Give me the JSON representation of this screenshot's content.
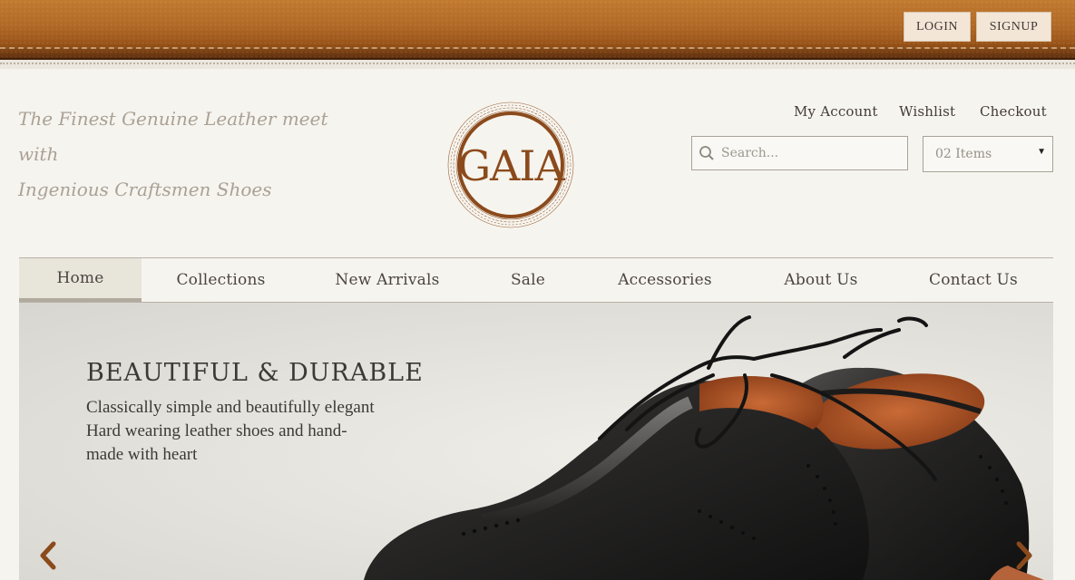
{
  "auth": {
    "login_label": "LOGIN",
    "signup_label": "SIGNUP"
  },
  "tagline": {
    "line1": "The Finest Genuine Leather meet with",
    "line2": "Ingenious Craftsmen Shoes"
  },
  "logo": {
    "text": "GAIA"
  },
  "top_links": [
    {
      "label": "My Account"
    },
    {
      "label": "Wishlist"
    },
    {
      "label": "Checkout"
    }
  ],
  "search": {
    "placeholder": "Search..."
  },
  "cart": {
    "label": "02 Items"
  },
  "nav": [
    {
      "label": "Home",
      "active": true
    },
    {
      "label": "Collections"
    },
    {
      "label": "New Arrivals"
    },
    {
      "label": "Sale"
    },
    {
      "label": "Accessories"
    },
    {
      "label": "About Us"
    },
    {
      "label": "Contact Us"
    }
  ],
  "hero": {
    "title": "BEAUTIFUL & DURABLE",
    "line1": "Classically simple and beautifully elegant",
    "line2": "Hard wearing leather shoes and hand-",
    "line3": "made with heart"
  },
  "colors": {
    "leather": "#b06826",
    "accent": "#8b4a1c",
    "background": "#f6f4ee"
  },
  "icons": {
    "search": "search-icon",
    "caret": "dropdown-caret-icon",
    "prev": "chevron-left-icon",
    "next": "chevron-right-icon"
  }
}
